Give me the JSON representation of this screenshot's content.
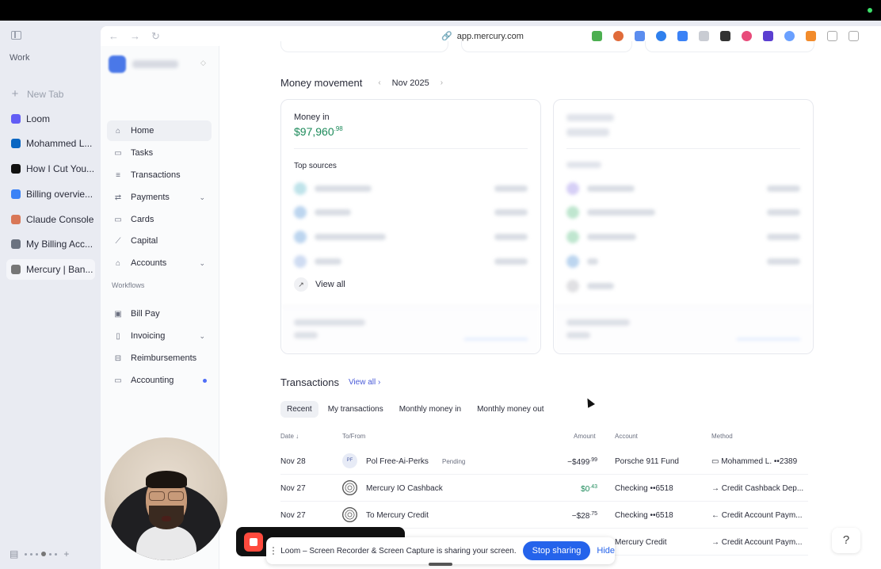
{
  "arc": {
    "space_name": "Work",
    "new_tab": "New Tab",
    "tabs": [
      {
        "label": "Loom",
        "icon": "loom-icon",
        "color": "#625df5"
      },
      {
        "label": "Mohammed L...",
        "icon": "linkedin-icon",
        "color": "#0a66c2"
      },
      {
        "label": "How I Cut You...",
        "icon": "notion-icon",
        "color": "#111111"
      },
      {
        "label": "Billing overvie...",
        "icon": "billing-icon",
        "color": "#3b82f6"
      },
      {
        "label": "Claude Console",
        "icon": "claude-icon",
        "color": "#d97757"
      },
      {
        "label": "My Billing Acc...",
        "icon": "gear-icon",
        "color": "#6b7280"
      },
      {
        "label": "Mercury | Ban...",
        "icon": "mercury-icon",
        "color": "#777777"
      }
    ]
  },
  "browser": {
    "url": "app.mercury.com"
  },
  "sidebar": {
    "items": [
      {
        "label": "Home",
        "icon": "home-icon",
        "glyph": "⌂"
      },
      {
        "label": "Tasks",
        "icon": "tasks-icon",
        "glyph": "▭"
      },
      {
        "label": "Transactions",
        "icon": "transactions-icon",
        "glyph": "≡"
      },
      {
        "label": "Payments",
        "icon": "payments-icon",
        "glyph": "⇄"
      },
      {
        "label": "Cards",
        "icon": "cards-icon",
        "glyph": "▭"
      },
      {
        "label": "Capital",
        "icon": "capital-icon",
        "glyph": "⟋"
      },
      {
        "label": "Accounts",
        "icon": "accounts-icon",
        "glyph": "⌂"
      }
    ],
    "workflows_label": "Workflows",
    "workflow_items": [
      {
        "label": "Bill Pay",
        "icon": "bill-pay-icon",
        "glyph": "▣"
      },
      {
        "label": "Invoicing",
        "icon": "invoicing-icon",
        "glyph": "▯"
      },
      {
        "label": "Reimbursements",
        "icon": "reimbursements-icon",
        "glyph": "⊟"
      },
      {
        "label": "Accounting",
        "icon": "accounting-icon",
        "glyph": "▭"
      }
    ]
  },
  "money_movement": {
    "title": "Money movement",
    "month": "Nov 2025",
    "money_in_label": "Money in",
    "money_in_whole": "$97,960",
    "money_in_cents": ".98",
    "top_sources_label": "Top sources",
    "view_all": "View all"
  },
  "transactions": {
    "title": "Transactions",
    "view_all": "View all",
    "tabs": [
      "Recent",
      "My transactions",
      "Monthly money in",
      "Monthly money out"
    ],
    "columns": {
      "date": "Date",
      "to_from": "To/From",
      "amount": "Amount",
      "account": "Account",
      "method": "Method"
    },
    "rows": [
      {
        "date": "Nov 28",
        "initials": "PF",
        "name": "Pol Free-Ai-Perks",
        "status": "Pending",
        "amount": "−$499",
        "cents": ".99",
        "account": "Porsche 911 Fund",
        "method": "Mohammed L. ••2389",
        "method_icon": "card-icon",
        "method_glyph": "▭"
      },
      {
        "date": "Nov 27",
        "initials": "",
        "name": "Mercury IO Cashback",
        "status": "",
        "amount": "$0",
        "cents": ".43",
        "account": "Checking ••6518",
        "method": "Credit Cashback Dep...",
        "method_icon": "arrow-right-icon",
        "method_glyph": "→"
      },
      {
        "date": "Nov 27",
        "initials": "",
        "name": "To Mercury Credit",
        "status": "",
        "amount": "−$28",
        "cents": ".75",
        "account": "Checking ••6518",
        "method": "Credit Account Paym...",
        "method_icon": "arrow-left-icon",
        "method_glyph": "←"
      },
      {
        "date": "",
        "initials": "",
        "name": "",
        "status": "",
        "amount": "",
        "cents": "",
        "account": "Mercury Credit",
        "method": "Credit Account Paym...",
        "method_icon": "arrow-right-icon",
        "method_glyph": "→"
      }
    ]
  },
  "share_bar": {
    "message": "Loom – Screen Recorder & Screen Capture is sharing your screen.",
    "stop": "Stop sharing",
    "hide": "Hide"
  },
  "help_label": "?"
}
